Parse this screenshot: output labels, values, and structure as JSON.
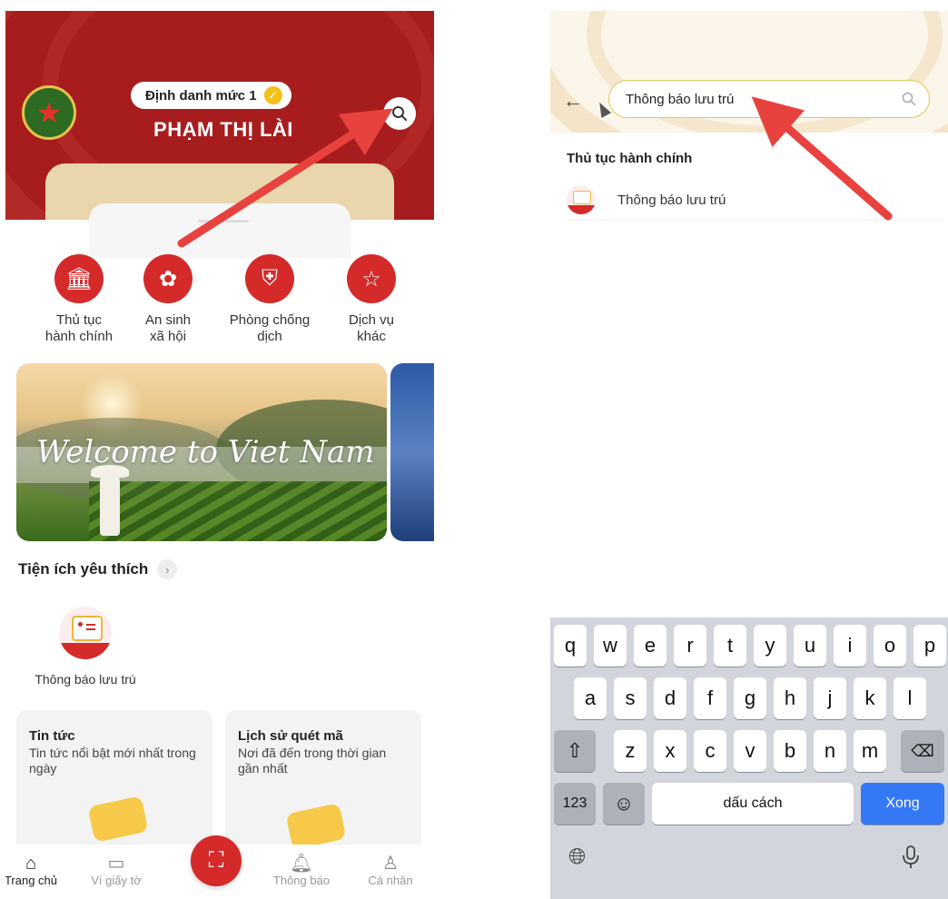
{
  "left": {
    "header": {
      "badge": "Định danh mức 1",
      "user_name": "PHẠM THỊ LÀI"
    },
    "services": [
      {
        "label": "Thủ tục\nhành chính",
        "icon": "building-icon"
      },
      {
        "label": "An sinh\nxã hội",
        "icon": "family-icon"
      },
      {
        "label": "Phòng chống\ndịch",
        "icon": "shield-icon"
      },
      {
        "label": "Dịch vụ\nkhác",
        "icon": "star-icon"
      }
    ],
    "banner": {
      "text": "Welcome to Viet Nam"
    },
    "favorites": {
      "title": "Tiện ích yêu thích",
      "items": [
        {
          "label": "Thông báo lưu trú",
          "icon": "notice-doc-icon"
        }
      ]
    },
    "cards": [
      {
        "title": "Tin tức",
        "desc": "Tin tức nổi bật mới nhất trong ngày"
      },
      {
        "title": "Lịch sử quét mã",
        "desc": "Nơi đã đến trong thời gian gần nhất"
      }
    ],
    "tabs": [
      {
        "label": "Trang chủ",
        "icon": "home-icon",
        "active": true
      },
      {
        "label": "Ví giấy tờ",
        "icon": "wallet-icon",
        "active": false
      },
      {
        "label": "Thông báo",
        "icon": "bell-icon",
        "active": false
      },
      {
        "label": "Cá nhân",
        "icon": "person-icon",
        "active": false
      }
    ]
  },
  "right": {
    "search": {
      "value": "Thông báo lưu trú"
    },
    "section_title": "Thủ tục hành chính",
    "results": [
      {
        "label": "Thông báo lưu trú"
      }
    ],
    "keyboard": {
      "row1": [
        "q",
        "w",
        "e",
        "r",
        "t",
        "y",
        "u",
        "i",
        "o",
        "p"
      ],
      "row2": [
        "a",
        "s",
        "d",
        "f",
        "g",
        "h",
        "j",
        "k",
        "l"
      ],
      "row3": [
        "z",
        "x",
        "c",
        "v",
        "b",
        "n",
        "m"
      ],
      "numbers_key": "123",
      "space_key": "dấu cách",
      "done_key": "Xong"
    }
  },
  "colors": {
    "brand_red": "#d52a2a",
    "header_red": "#a71d1d",
    "annotation_arrow": "#e8423f",
    "keyboard_blue": "#3478f6"
  }
}
